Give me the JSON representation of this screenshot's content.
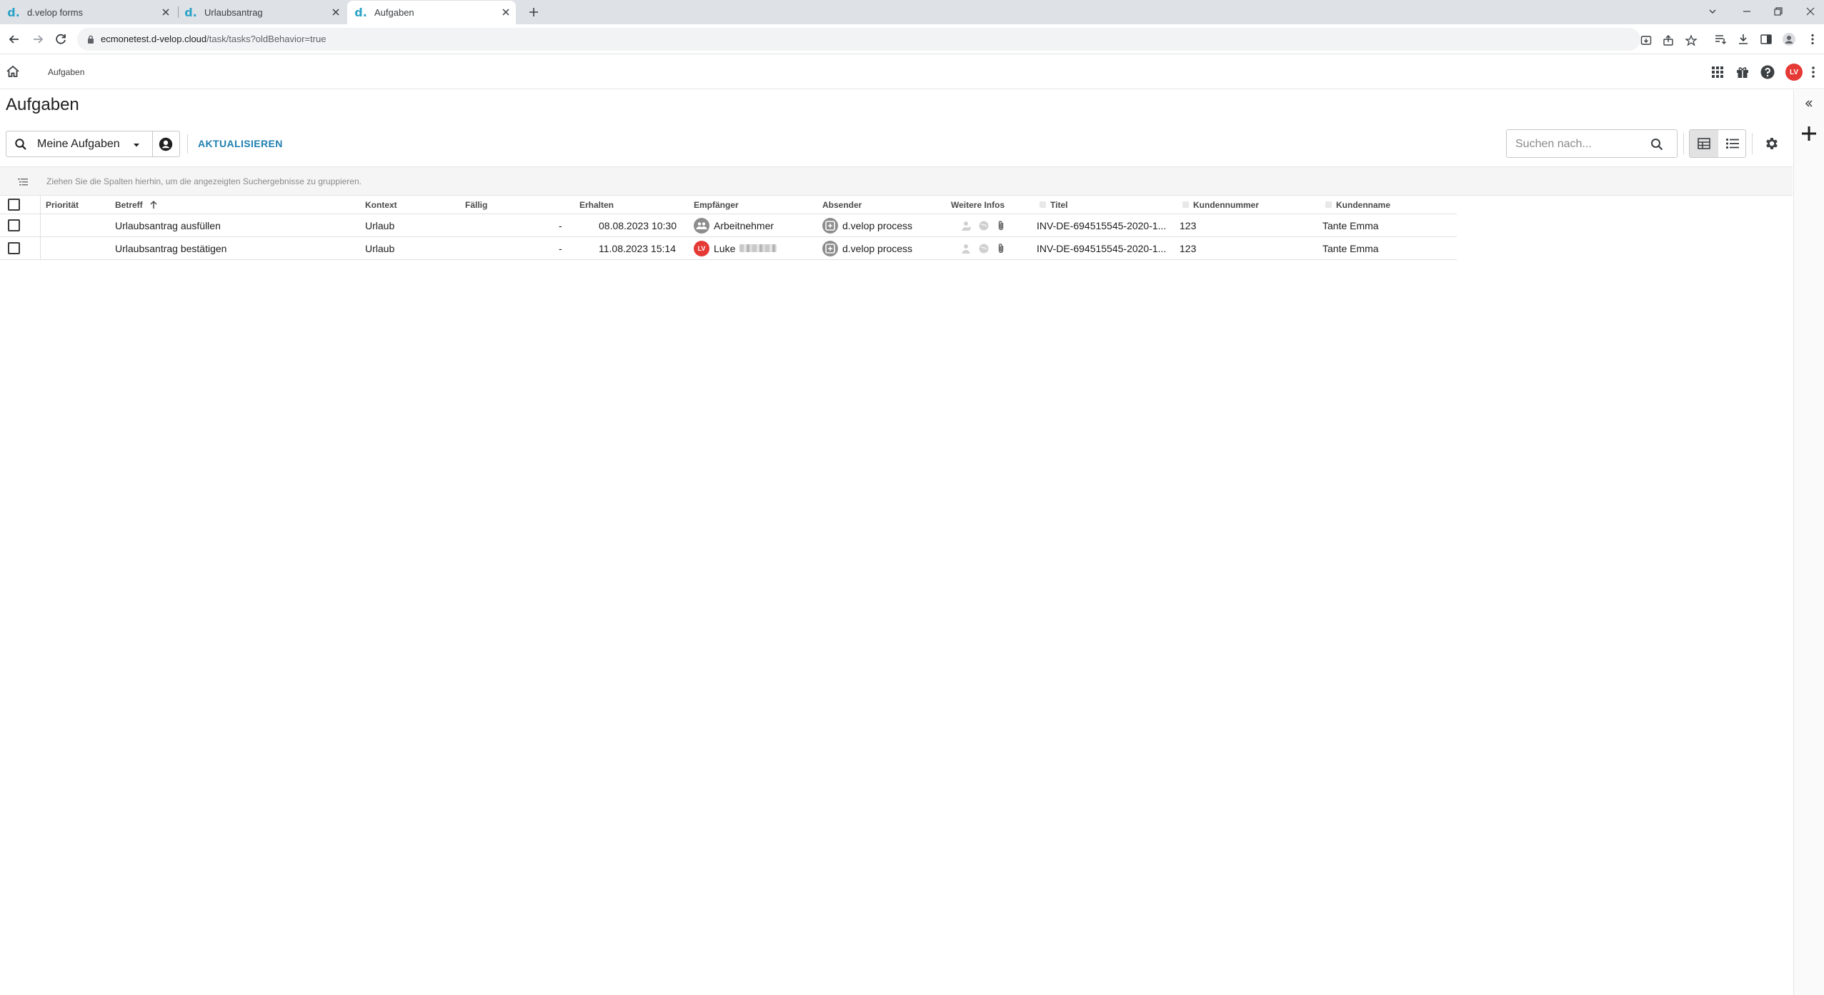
{
  "browser": {
    "tabs": [
      {
        "favicon": "d.",
        "title": "d.velop forms"
      },
      {
        "favicon": "d.",
        "title": "Urlaubsantrag"
      },
      {
        "favicon": "d.",
        "title": "Aufgaben"
      }
    ],
    "url_host": "ecmonetest.d-velop.cloud",
    "url_path": "/task/tasks?oldBehavior=true"
  },
  "header": {
    "breadcrumb": "Aufgaben",
    "avatar_initials": "LV"
  },
  "page": {
    "title": "Aufgaben",
    "scope_label": "Meine Aufgaben",
    "refresh_label": "AKTUALISIEREN",
    "search_placeholder": "Suchen nach...",
    "group_hint": "Ziehen Sie die Spalten hierhin, um die angezeigten Suchergebnisse zu gruppieren."
  },
  "table": {
    "columns": {
      "prioritaet": "Priorität",
      "betreff": "Betreff",
      "kontext": "Kontext",
      "faellig": "Fällig",
      "erhalten": "Erhalten",
      "empfaenger": "Empfänger",
      "absender": "Absender",
      "weitere_infos": "Weitere Infos",
      "titel": "Titel",
      "kundennummer": "Kundennummer",
      "kundenname": "Kundenname"
    },
    "rows": [
      {
        "betreff": "Urlaubsantrag ausfüllen",
        "kontext": "Urlaub",
        "faellig": "-",
        "erhalten": "08.08.2023 10:30",
        "empfaenger": "Arbeitnehmer",
        "empfaenger_avatar": "group-icon",
        "absender": "d.velop process",
        "titel": "INV-DE-694515545-2020-1...",
        "kundennummer": "123",
        "kundenname": "Tante Emma"
      },
      {
        "betreff": "Urlaubsantrag bestätigen",
        "kontext": "Urlaub",
        "faellig": "-",
        "erhalten": "11.08.2023 15:14",
        "empfaenger": "Luke",
        "empfaenger_avatar": "LV",
        "absender": "d.velop process",
        "titel": "INV-DE-694515545-2020-1...",
        "kundennummer": "123",
        "kundenname": "Tante Emma"
      }
    ]
  },
  "colors": {
    "accent": "#1f7fb0",
    "avatar_red": "#e53935",
    "avatar_grey": "#8d8d8d"
  }
}
